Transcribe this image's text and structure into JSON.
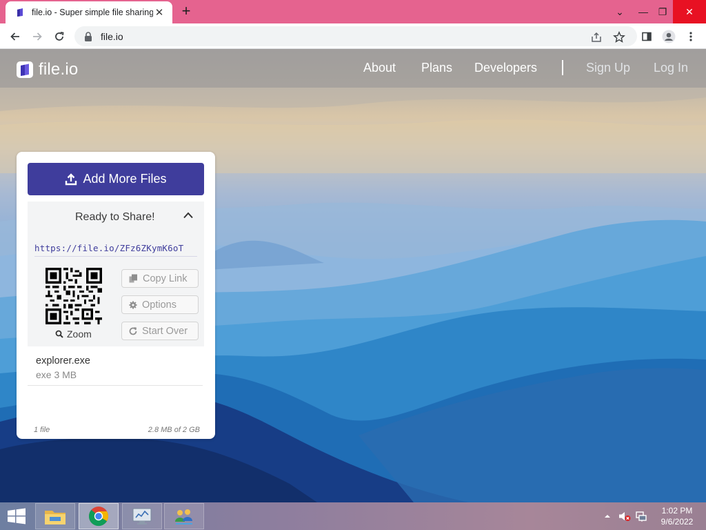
{
  "browser": {
    "tab_title": "file.io - Super simple file sharing",
    "url": "file.io"
  },
  "site": {
    "logo_text": "file.io",
    "nav": [
      "About",
      "Plans",
      "Developers"
    ],
    "auth": [
      "Sign Up",
      "Log In"
    ]
  },
  "card": {
    "add_button": "Add More Files",
    "share_title": "Ready to Share!",
    "share_link": "https://file.io/ZFz6ZKymK6oT",
    "zoom_label": "Zoom",
    "actions": [
      "Copy Link",
      "Options",
      "Start Over"
    ],
    "file": {
      "name": "explorer.exe",
      "meta": "exe 3 MB"
    },
    "footer_count": "1 file",
    "footer_usage": "2.8 MB of 2 GB"
  },
  "taskbar": {
    "time": "1:02 PM",
    "date": "9/6/2022"
  },
  "colors": {
    "tabstrip": "#e5638f",
    "brand_button": "#3f3d9c",
    "close_button": "#e81123"
  },
  "icons": [
    "favicon-icon",
    "back-icon",
    "forward-icon",
    "reload-icon",
    "lock-icon",
    "share-page-icon",
    "star-icon",
    "sidepanel-icon",
    "profile-icon",
    "menu-icon",
    "upload-icon",
    "chevron-up-icon",
    "search-icon",
    "copy-icon",
    "gear-icon",
    "refresh-icon",
    "windows-start-icon",
    "file-explorer-icon",
    "chrome-icon",
    "monitor-icon",
    "network-people-icon",
    "tray-arrow-icon",
    "speaker-muted-icon",
    "network-icon"
  ]
}
